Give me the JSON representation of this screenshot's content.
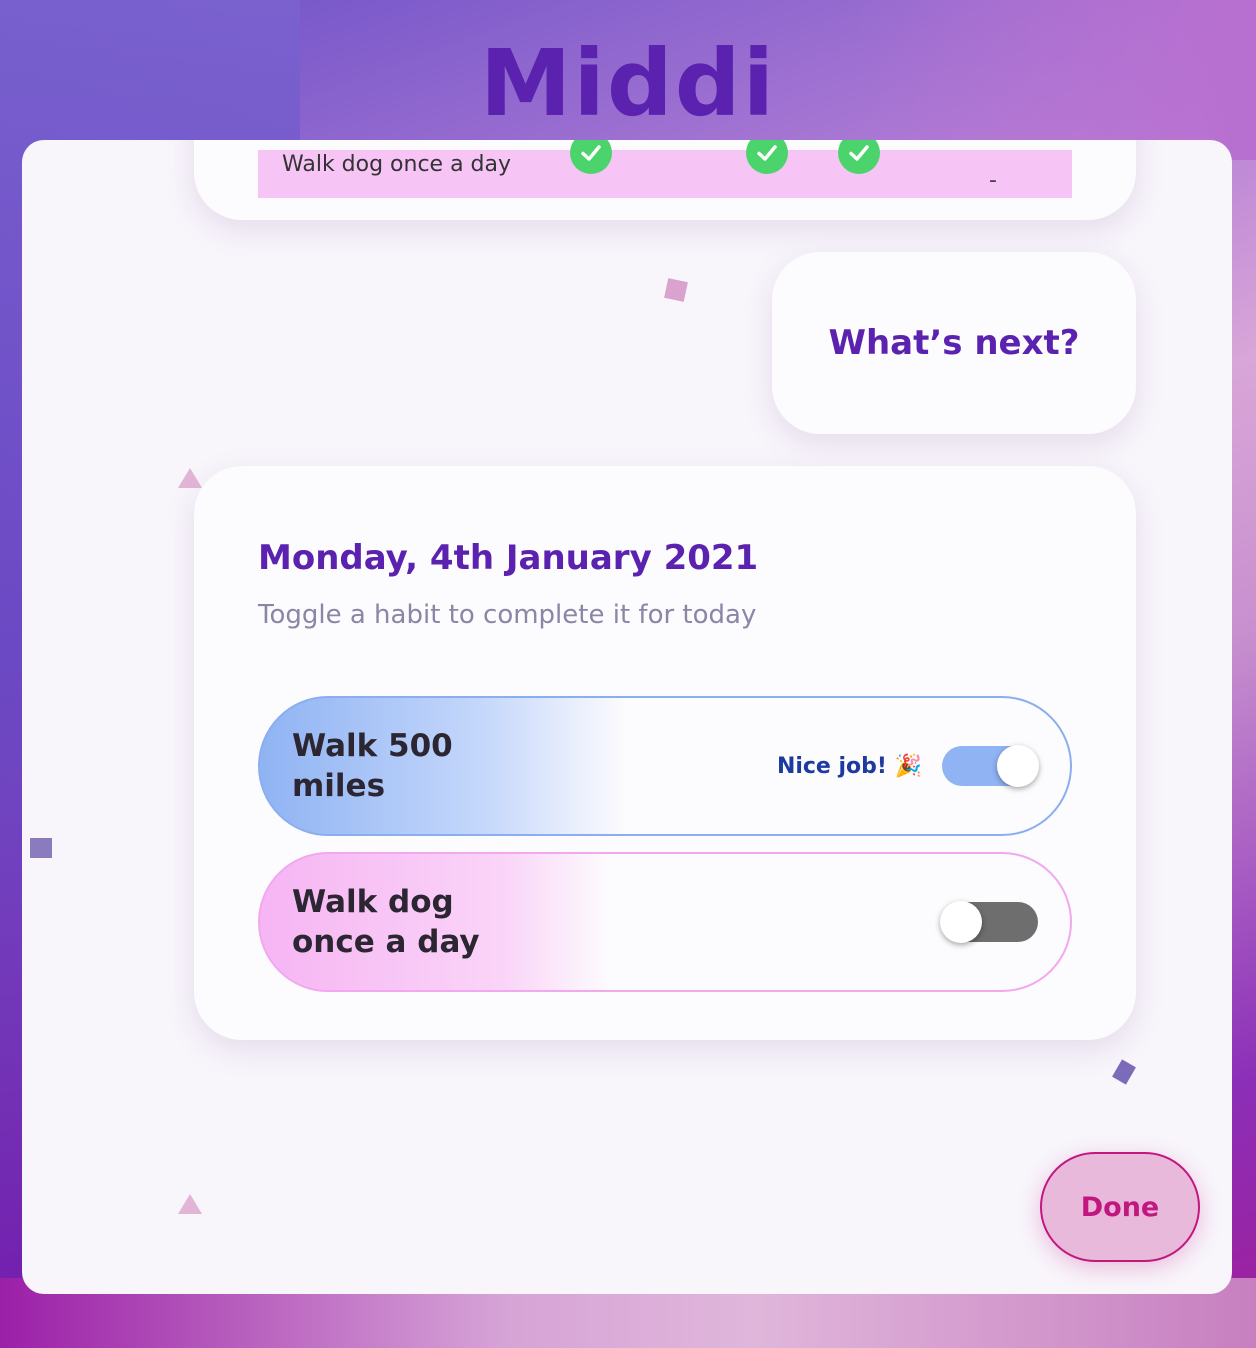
{
  "app": {
    "logo": "Middi"
  },
  "summary_table": {
    "row_label": "Walk dog once a day",
    "cells": [
      "check",
      "-",
      "check",
      "check",
      "-",
      "-"
    ]
  },
  "next_card": {
    "label": "What’s next?"
  },
  "today": {
    "date": "Monday, 4th January 2021",
    "subtitle": "Toggle a habit to complete it for today",
    "habits": [
      {
        "name_line1": "Walk 500",
        "name_line2": "miles",
        "status": "Nice job! 🎉",
        "completed": true
      },
      {
        "name_line1": "Walk dog",
        "name_line2": "once a day",
        "status": "",
        "completed": false
      }
    ]
  },
  "actions": {
    "done_label": "Done"
  },
  "colors": {
    "accent": "#5b22b0",
    "done": "#c2177f",
    "check": "#4cd46c"
  },
  "icons": [
    "check-icon",
    "party-popper-icon"
  ]
}
